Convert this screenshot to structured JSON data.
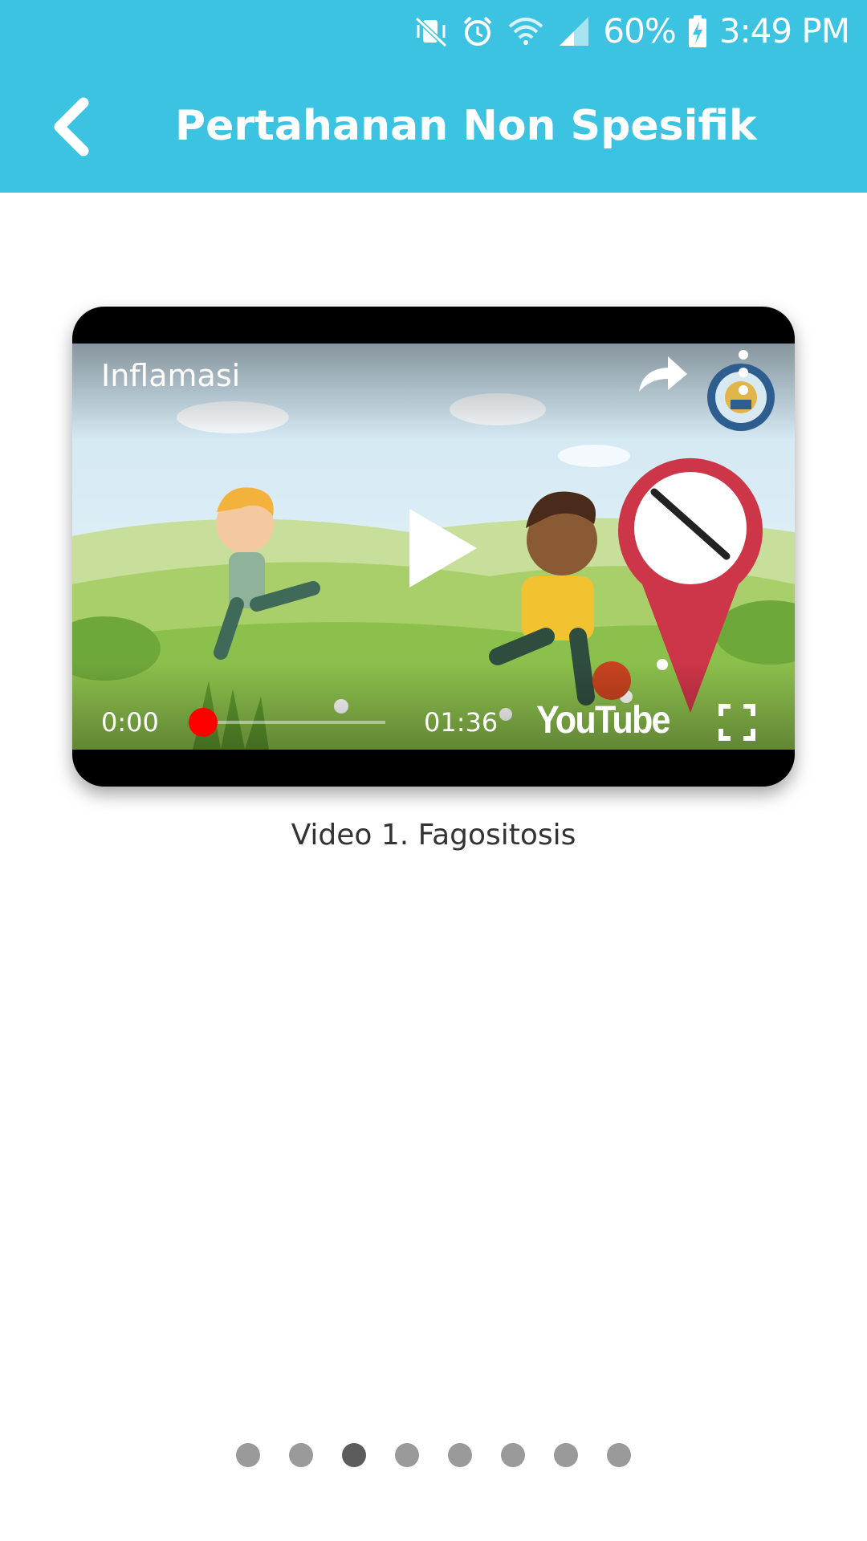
{
  "status_bar": {
    "battery": "60%",
    "time": "3:49 PM",
    "icons": [
      "mute-vibrate-icon",
      "alarm-icon",
      "wifi-icon",
      "signal-icon",
      "battery-charging-icon"
    ]
  },
  "app_bar": {
    "title": "Pertahanan Non Spesifik",
    "back_icon": "chevron-left-icon",
    "color": "#3cc3e2"
  },
  "video": {
    "title": "Inflamasi",
    "current_time": "0:00",
    "duration": "01:36",
    "progress": 0,
    "logo_text": "YouTube",
    "caption": "Video 1. Fagositosis",
    "controls": [
      "share-icon",
      "more-vert-icon",
      "play-icon",
      "fullscreen-icon"
    ]
  },
  "pager": {
    "count": 8,
    "active_index": 2,
    "dots": [
      "",
      "",
      "",
      "",
      "",
      "",
      "",
      ""
    ]
  }
}
